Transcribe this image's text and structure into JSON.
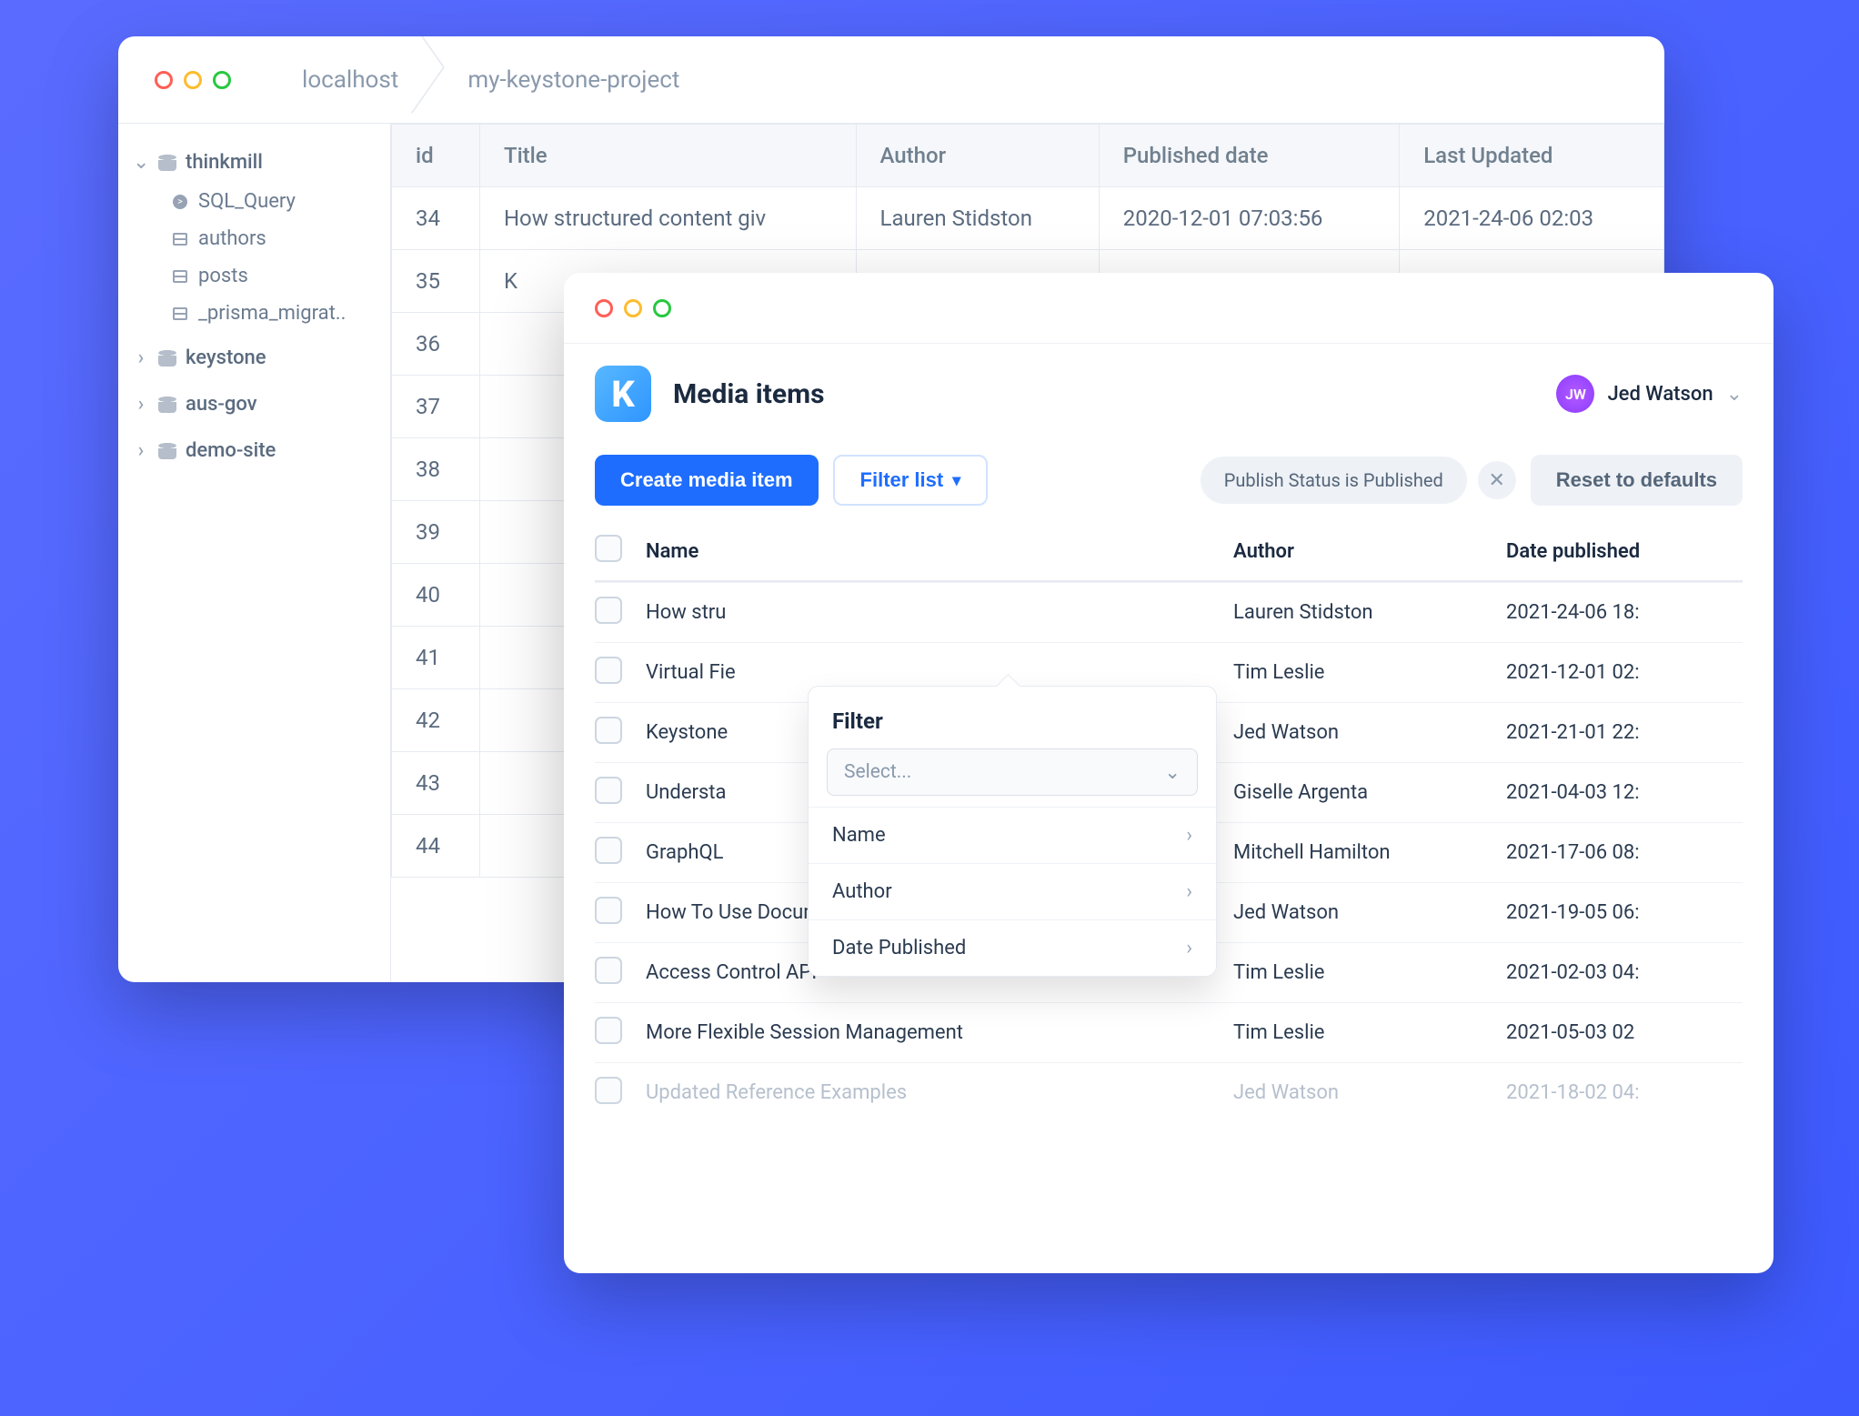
{
  "db": {
    "breadcrumb": [
      "localhost",
      "my-keystone-project"
    ],
    "sidebar": {
      "groups": [
        {
          "name": "thinkmill",
          "expanded": true,
          "children": [
            {
              "kind": "terminal",
              "label": "SQL_Query"
            },
            {
              "kind": "table",
              "label": "authors"
            },
            {
              "kind": "table",
              "label": "posts"
            },
            {
              "kind": "table",
              "label": "_prisma_migrat.."
            }
          ]
        },
        {
          "name": "keystone",
          "expanded": false,
          "children": []
        },
        {
          "name": "aus-gov",
          "expanded": false,
          "children": []
        },
        {
          "name": "demo-site",
          "expanded": false,
          "children": []
        }
      ]
    },
    "columns": [
      "id",
      "Title",
      "Author",
      "Published date",
      "Last Updated"
    ],
    "rows": [
      {
        "id": "34",
        "title": "How structured content giv",
        "author": "Lauren Stidston",
        "pub": "2020-12-01 07:03:56",
        "upd": "2021-24-06 02:03"
      },
      {
        "id": "35",
        "title": "K",
        "author": "",
        "pub": "",
        "upd": ""
      },
      {
        "id": "36",
        "title": "",
        "author": "",
        "pub": "",
        "upd": ""
      },
      {
        "id": "37",
        "title": "",
        "author": "",
        "pub": "",
        "upd": ""
      },
      {
        "id": "38",
        "title": "",
        "author": "",
        "pub": "",
        "upd": ""
      },
      {
        "id": "39",
        "title": "",
        "author": "",
        "pub": "",
        "upd": ""
      },
      {
        "id": "40",
        "title": "",
        "author": "",
        "pub": "",
        "upd": ""
      },
      {
        "id": "41",
        "title": "",
        "author": "",
        "pub": "",
        "upd": ""
      },
      {
        "id": "42",
        "title": "",
        "author": "",
        "pub": "",
        "upd": ""
      },
      {
        "id": "43",
        "title": "",
        "author": "",
        "pub": "",
        "upd": ""
      },
      {
        "id": "44",
        "title": "",
        "author": "",
        "pub": "",
        "upd": ""
      }
    ]
  },
  "ks": {
    "logo_letter": "K",
    "page_title": "Media items",
    "user": {
      "initials": "JW",
      "name": "Jed Watson"
    },
    "toolbar": {
      "create_label": "Create media item",
      "filter_label": "Filter list",
      "active_filter": "Publish Status is Published",
      "reset_label": "Reset to defaults"
    },
    "columns": {
      "name": "Name",
      "author": "Author",
      "date": "Date published"
    },
    "filter_popover": {
      "title": "Filter",
      "select_placeholder": "Select...",
      "options": [
        "Name",
        "Author",
        "Date Published"
      ]
    },
    "rows": [
      {
        "name": "How stru",
        "author": "Lauren Stidston",
        "date": "2021-24-06 18:",
        "fade": false
      },
      {
        "name": "Virtual Fie",
        "author": "Tim Leslie",
        "date": "2021-12-01 02:",
        "fade": false
      },
      {
        "name": "Keystone",
        "author": "Jed Watson",
        "date": "2021-21-01 22:",
        "fade": false
      },
      {
        "name": "Understa",
        "author": "Giselle Argenta",
        "date": "2021-04-03 12:",
        "fade": false
      },
      {
        "name": "GraphQL",
        "author": "Mitchell Hamilton",
        "date": "2021-17-06 08:",
        "fade": false
      },
      {
        "name": "How To Use Document Fields",
        "author": "Jed Watson",
        "date": "2021-19-05 06:",
        "fade": false
      },
      {
        "name": "Access Control API",
        "author": "Tim Leslie",
        "date": "2021-02-03 04:",
        "fade": false
      },
      {
        "name": "More Flexible Session Management",
        "author": "Tim Leslie",
        "date": "2021-05-03 02",
        "fade": false
      },
      {
        "name": "Updated Reference Examples",
        "author": "Jed Watson",
        "date": "2021-18-02 04:",
        "fade": true
      }
    ]
  }
}
